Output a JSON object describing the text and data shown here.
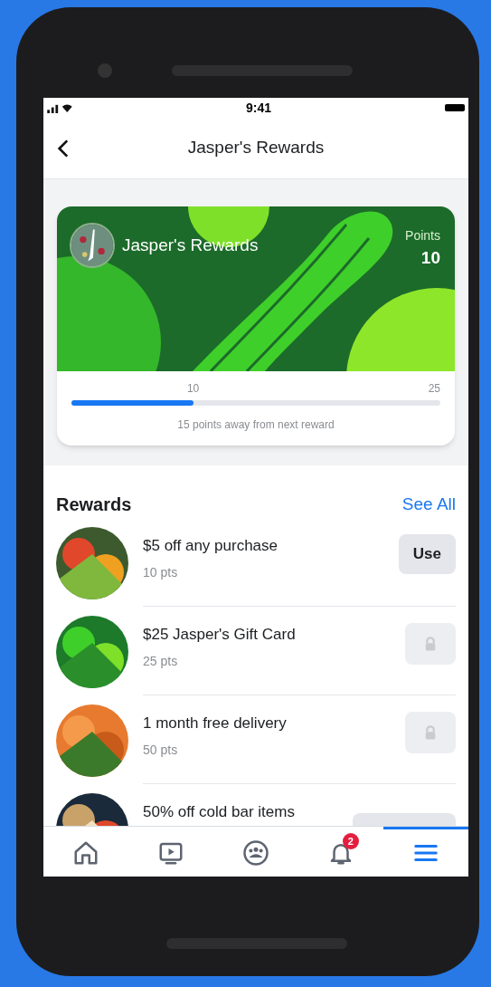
{
  "status_bar": {
    "time": "9:41"
  },
  "header": {
    "title": "Jasper's Rewards"
  },
  "card": {
    "name": "Jasper's Rewards",
    "points_label": "Points",
    "points": "10",
    "progress": {
      "level": 0.33,
      "current_label": "10",
      "goal_label": "25"
    },
    "message": "15 points away from next reward"
  },
  "rewards": {
    "title": "Rewards",
    "see_all": "See All",
    "items": [
      {
        "title": "$5 off any purchase",
        "points": "10 pts",
        "action": {
          "kind": "button",
          "label": "Use"
        }
      },
      {
        "title": "$25 Jasper's Gift Card",
        "points": "25 pts",
        "action": {
          "kind": "locked"
        }
      },
      {
        "title": "1 month free delivery",
        "points": "50 pts",
        "action": {
          "kind": "locked"
        }
      },
      {
        "title": "50% off cold bar items",
        "action": {
          "kind": "hidden"
        }
      }
    ]
  },
  "tab_bar": [
    {
      "kind": "home",
      "selected": false
    },
    {
      "kind": "video",
      "selected": false
    },
    {
      "kind": "groups",
      "selected": false
    },
    {
      "kind": "bell",
      "selected": false,
      "badge": "2"
    },
    {
      "kind": "menu",
      "selected": true
    }
  ]
}
